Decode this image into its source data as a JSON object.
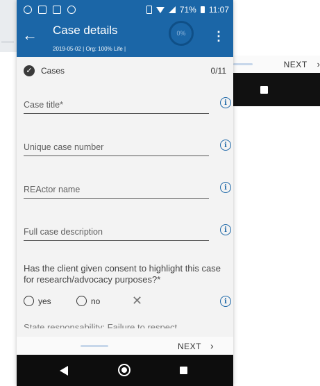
{
  "status_bar": {
    "battery_percent": "71%",
    "time": "11:07"
  },
  "app_bar": {
    "title": "Case details",
    "subtitle": "2019-05-02 | Org: 100% Life |",
    "progress_label": "0%"
  },
  "section": {
    "label": "Cases",
    "count": "0/11"
  },
  "fields": [
    {
      "label": "Case title*"
    },
    {
      "label": "Unique case number"
    },
    {
      "label": "REActor name"
    },
    {
      "label": "Full case description"
    }
  ],
  "consent_question": {
    "text": "Has the client given consent to highlight this case for research/advocacy purposes?*",
    "options": [
      "yes",
      "no"
    ],
    "clear_symbol": "✕"
  },
  "next_question_partial": "State responsability: Failure to respect",
  "footer": {
    "next_label": "NEXT",
    "chevron": "›"
  },
  "background_app": {
    "next_label": "NEXT",
    "chevron": "›"
  },
  "colors": {
    "primary": "#1b66a7",
    "navbar": "#0d0d0d"
  },
  "icons": [
    "back-arrow-icon",
    "more-vert-icon",
    "check-circle-icon",
    "info-icon",
    "close-icon",
    "nav-back-icon",
    "nav-home-icon",
    "nav-recents-icon"
  ]
}
